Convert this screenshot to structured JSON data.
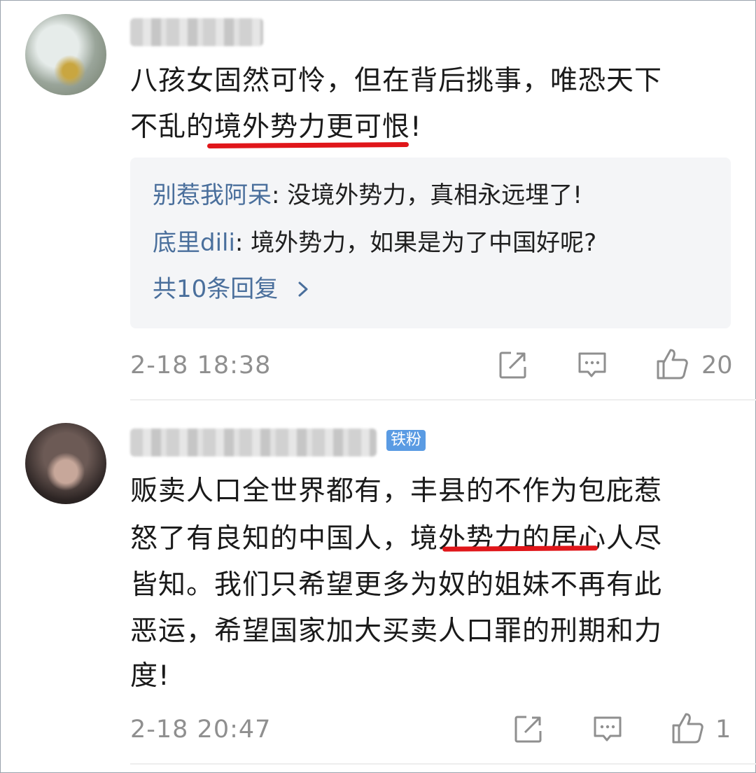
{
  "comments": [
    {
      "text_line1": "八孩女固然可怜，但在背后挑事，唯恐天下",
      "text_line2": "不乱的境外势力更可恨!",
      "replies": [
        {
          "name": "别惹我阿呆",
          "text": ": 没境外势力，真相永远埋了!"
        },
        {
          "name": "底里dili",
          "text": ": 境外势力，如果是为了中国好呢?"
        }
      ],
      "more_replies": "共10条回复",
      "time": "2-18 18:38",
      "likes": "20"
    },
    {
      "badge": "铁粉",
      "lines": [
        "贩卖人口全世界都有，丰县的不作为包庇惹",
        "怒了有良知的中国人，境外势力的居心人尽",
        "皆知。我们只希望更多为奴的姐妹不再有此",
        "恶运，希望国家加大买卖人口罪的刑期和力",
        "度!"
      ],
      "time": "2-18 20:47",
      "likes": "1"
    }
  ],
  "icons": [
    "share-icon",
    "comment-icon",
    "like-icon"
  ],
  "colors": {
    "underline": "#e0161a",
    "link": "#4a6f9c",
    "badge": "#5a9be3",
    "meta": "#8f8f8f"
  }
}
